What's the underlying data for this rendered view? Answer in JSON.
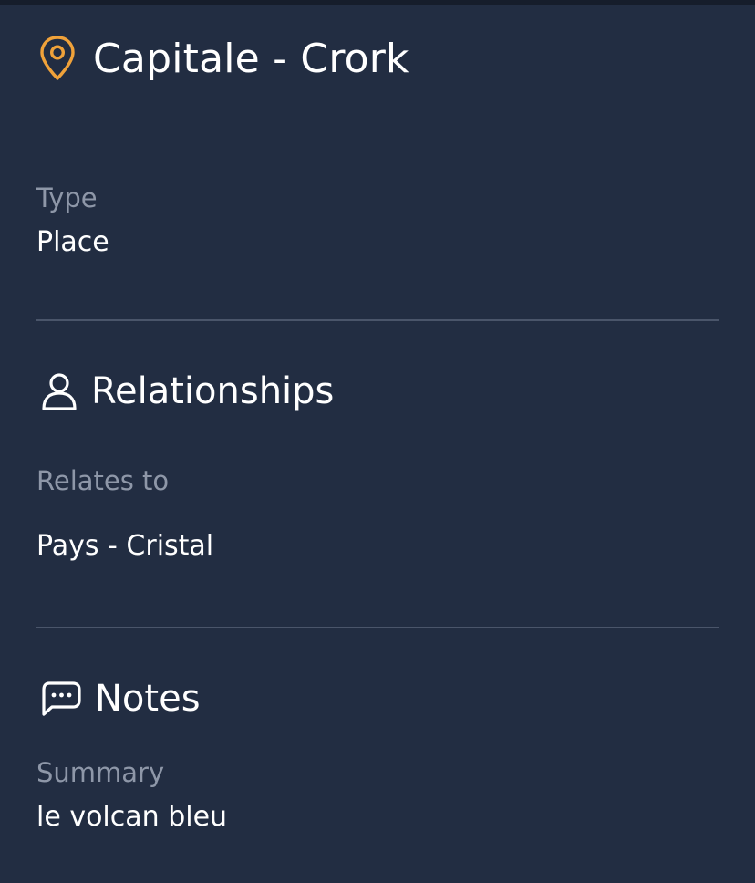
{
  "header": {
    "title": "Capitale - Crork",
    "icon": "map-pin-icon",
    "icon_color": "#f0a23a"
  },
  "details": {
    "type_label": "Type",
    "type_value": "Place"
  },
  "relationships": {
    "title": "Relationships",
    "icon": "user-icon",
    "relates_to_label": "Relates to",
    "items": [
      "Pays - Cristal"
    ]
  },
  "notes": {
    "title": "Notes",
    "icon": "chat-bubble-icon",
    "summary_label": "Summary",
    "summary_value": "le volcan bleu"
  },
  "colors": {
    "background": "#222d42",
    "muted_text": "#8e97a8",
    "divider": "#4a556a",
    "accent": "#f0a23a"
  }
}
